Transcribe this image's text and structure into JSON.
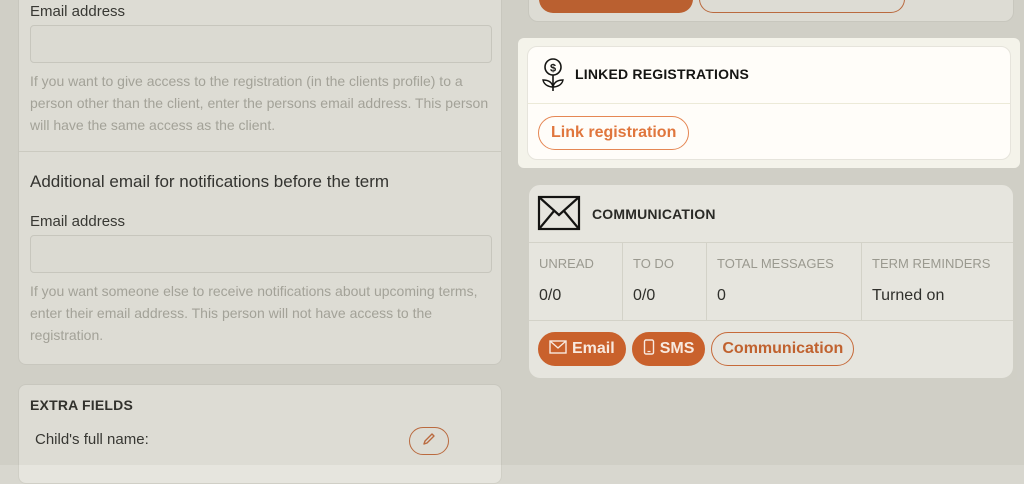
{
  "left": {
    "access_email": {
      "label": "Email address",
      "value": "",
      "help": "If you want to give access to the registration (in the clients profile) to a person other than the client, enter the persons email address. This person will have the same access as the client."
    },
    "notifications": {
      "title": "Additional email for notifications before the term",
      "label": "Email address",
      "value": "",
      "help": "If you want someone else to receive notifications about upcoming terms, enter their email address. This person will not have access to the registration."
    },
    "extra_fields": {
      "title": "EXTRA FIELDS",
      "child_label": "Child's full name:",
      "edit_icon": "pencil-icon"
    }
  },
  "linked_registrations": {
    "title": "LINKED REGISTRATIONS",
    "icon": "money-plant-icon",
    "link_button": "Link registration"
  },
  "communication": {
    "title": "COMMUNICATION",
    "icon": "envelope-icon",
    "stats": [
      {
        "label": "UNREAD",
        "value": "0/0"
      },
      {
        "label": "TO DO",
        "value": "0/0"
      },
      {
        "label": "TOTAL MESSAGES",
        "value": "0"
      },
      {
        "label": "TERM REMINDERS",
        "value": "Turned on"
      }
    ],
    "buttons": {
      "email": "Email",
      "sms": "SMS",
      "communication": "Communication"
    }
  },
  "colors": {
    "accent": "#e0763d",
    "accent_dim": "#c9612c",
    "background": "#d8d7cf",
    "card": "#e6e5de",
    "highlight_card": "#fffdf9"
  }
}
